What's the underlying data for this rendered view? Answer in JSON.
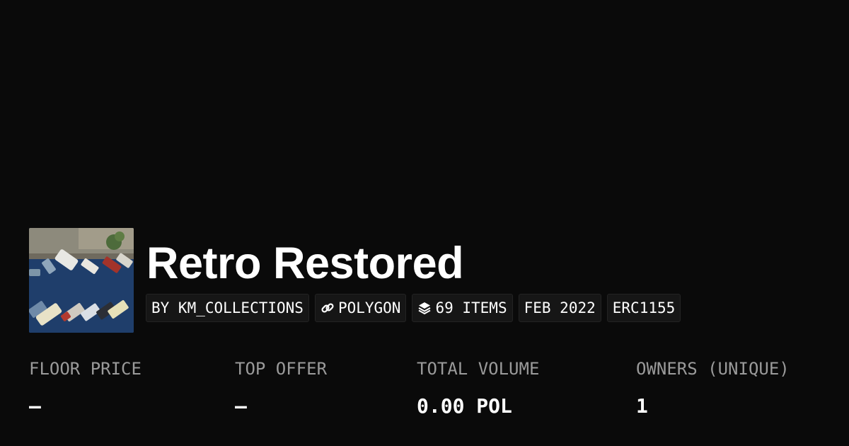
{
  "collection": {
    "title": "Retro Restored",
    "thumbnail_icon": "parking-lot-photo"
  },
  "badges": [
    {
      "label": "BY KM_COLLECTIONS",
      "icon": null
    },
    {
      "label": "POLYGON",
      "icon": "chain-link-icon"
    },
    {
      "label": "69 ITEMS",
      "icon": "layers-icon"
    },
    {
      "label": "FEB 2022",
      "icon": null
    },
    {
      "label": "ERC1155",
      "icon": null
    }
  ],
  "stats": [
    {
      "label": "FLOOR PRICE",
      "value": "–"
    },
    {
      "label": "TOP OFFER",
      "value": "–"
    },
    {
      "label": "TOTAL VOLUME",
      "value": "0.00 POL"
    },
    {
      "label": "OWNERS (UNIQUE)",
      "value": "1"
    }
  ],
  "colors": {
    "background": "#0a0a0a",
    "badge_background": "#161616",
    "label_gray": "#9a9a9a",
    "text": "#ffffff"
  }
}
